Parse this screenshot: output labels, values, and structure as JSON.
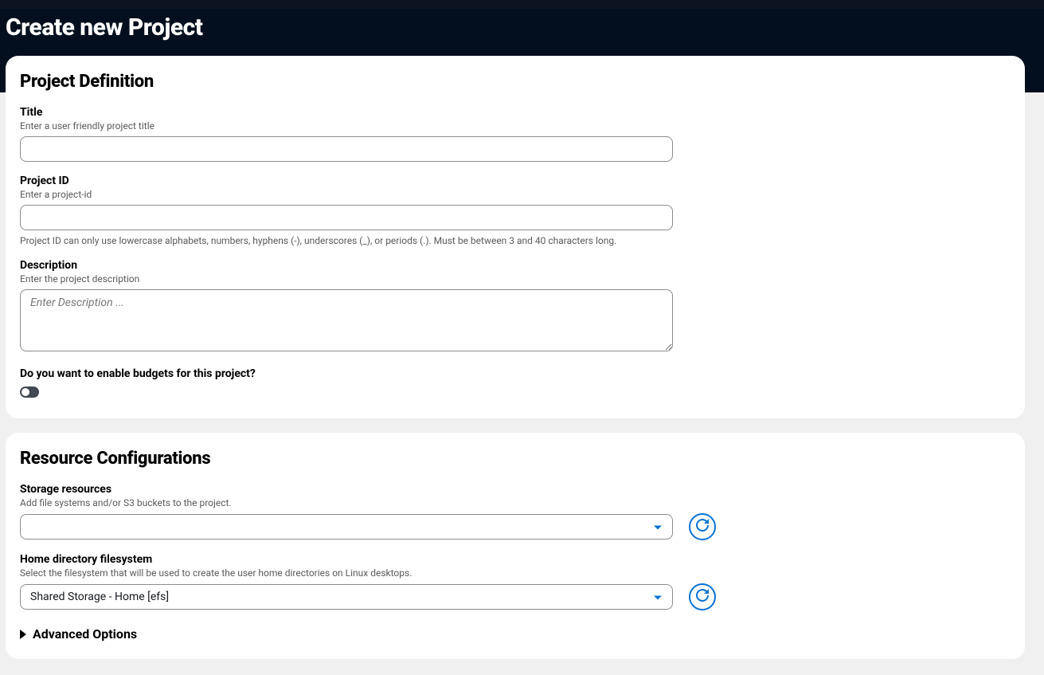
{
  "header": {
    "title": "Create new Project"
  },
  "projectDefinition": {
    "sectionTitle": "Project Definition",
    "title": {
      "label": "Title",
      "hint": "Enter a user friendly project title",
      "value": ""
    },
    "projectId": {
      "label": "Project ID",
      "hint": "Enter a project-id",
      "value": "",
      "help": "Project ID can only use lowercase alphabets, numbers, hyphens (-), underscores (_), or periods (.). Must be between 3 and 40 characters long."
    },
    "description": {
      "label": "Description",
      "hint": "Enter the project description",
      "placeholder": "Enter Description ...",
      "value": ""
    },
    "budgets": {
      "label": "Do you want to enable budgets for this project?",
      "enabled": false
    }
  },
  "resourceConfigurations": {
    "sectionTitle": "Resource Configurations",
    "storage": {
      "label": "Storage resources",
      "hint": "Add file systems and/or S3 buckets to the project.",
      "value": ""
    },
    "homeDir": {
      "label": "Home directory filesystem",
      "hint": "Select the filesystem that will be used to create the user home directories on Linux desktops.",
      "value": "Shared Storage - Home [efs]"
    },
    "advancedLabel": "Advanced Options"
  },
  "colors": {
    "accent": "#0972d3",
    "headerBg": "#030f1e"
  }
}
